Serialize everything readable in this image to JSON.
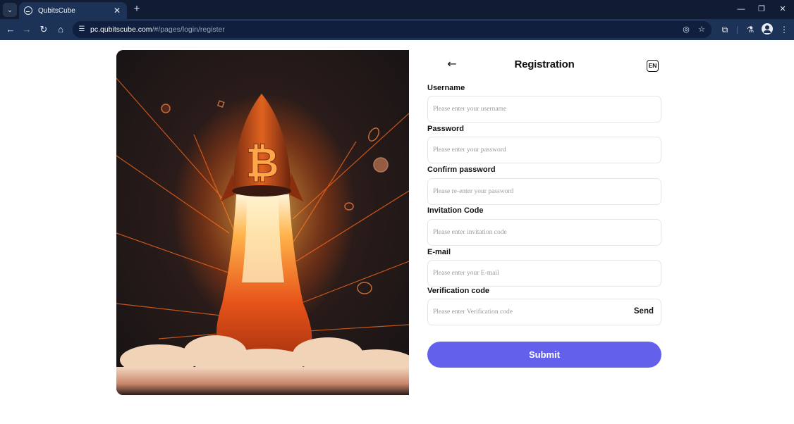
{
  "browser": {
    "tab_title": "QubitsCube",
    "url_host": "pc.qubitscube.com",
    "url_path": "/#/pages/login/register"
  },
  "page": {
    "title": "Registration",
    "language_label": "EN"
  },
  "form": {
    "username": {
      "label": "Username",
      "placeholder": "Please enter your username"
    },
    "password": {
      "label": "Password",
      "placeholder": "Please enter your password"
    },
    "confirm_password": {
      "label": "Confirm password",
      "placeholder": "Please re-enter your password"
    },
    "invitation_code": {
      "label": "Invitation Code",
      "placeholder": "Please enter invitation code"
    },
    "email": {
      "label": "E-mail",
      "placeholder": "Please enter your E-mail"
    },
    "verification_code": {
      "label": "Verification code",
      "placeholder": "Please enter Verification code",
      "send_label": "Send"
    },
    "submit_label": "Submit"
  },
  "colors": {
    "browser_chrome": "#1d3257",
    "submit_button": "#6360ec",
    "hero_glow": "#ff6a1a"
  }
}
